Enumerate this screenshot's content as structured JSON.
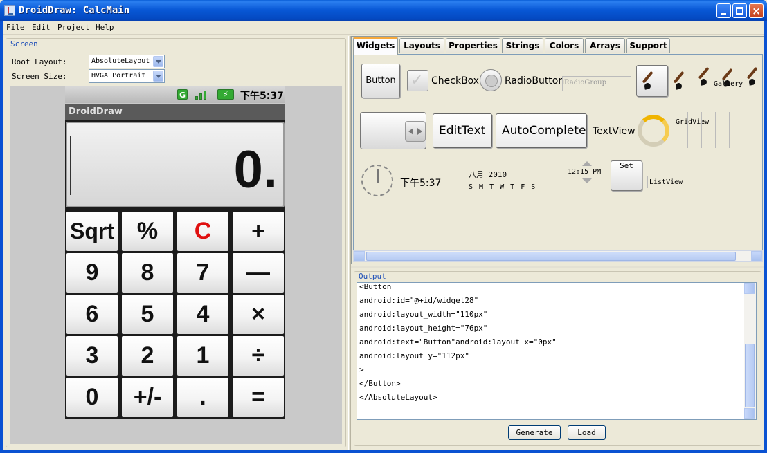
{
  "window": {
    "title": "DroidDraw: CalcMain"
  },
  "menu": [
    "File",
    "Edit",
    "Project",
    "Help"
  ],
  "screen": {
    "panel_title": "Screen",
    "root_layout_label": "Root Layout:",
    "root_layout_value": "AbsoluteLayout",
    "screen_size_label": "Screen Size:",
    "screen_size_value": "HVGA Portrait"
  },
  "device": {
    "status_time": "下午5:37",
    "app_title": "DroidDraw",
    "display_value": "0.",
    "keys": [
      [
        "Sqrt",
        "%",
        "C",
        "+"
      ],
      [
        "9",
        "8",
        "7",
        "—"
      ],
      [
        "6",
        "5",
        "4",
        "×"
      ],
      [
        "3",
        "2",
        "1",
        "÷"
      ],
      [
        "0",
        "+/-",
        ".",
        "="
      ]
    ]
  },
  "tabs": [
    "Widgets",
    "Layouts",
    "Properties",
    "Strings",
    "Colors",
    "Arrays",
    "Support"
  ],
  "active_tab": "Widgets",
  "widgets": {
    "button": "Button",
    "checkbox": "CheckBox",
    "radiobutton": "RadioButton",
    "radiogroup": "RadioGroup",
    "gallery": "Gallery",
    "edittext": "EditText",
    "autocomplete": "AutoComplete",
    "textview": "TextView",
    "gridview": "GridView",
    "clock_time": "下午5:37",
    "date_month": "八月 2010",
    "date_days": "S M T W T F S",
    "time_picker": "12:15 PM",
    "set_button": "Set",
    "listview": "ListView"
  },
  "output": {
    "panel_title": "Output",
    "lines": [
      "<Button",
      "android:id=\"@+id/widget28\"",
      "android:layout_width=\"110px\"",
      "android:layout_height=\"76px\"",
      "android:text=\"Button\"android:layout_x=\"0px\"",
      "android:layout_y=\"112px\"",
      ">",
      "</Button>",
      "</AbsoluteLayout>"
    ],
    "generate_label": "Generate",
    "load_label": "Load"
  },
  "colors": {
    "titlebar": "#0858d6",
    "accent_tab": "#f6a93c",
    "clear_key": "#e01010"
  }
}
